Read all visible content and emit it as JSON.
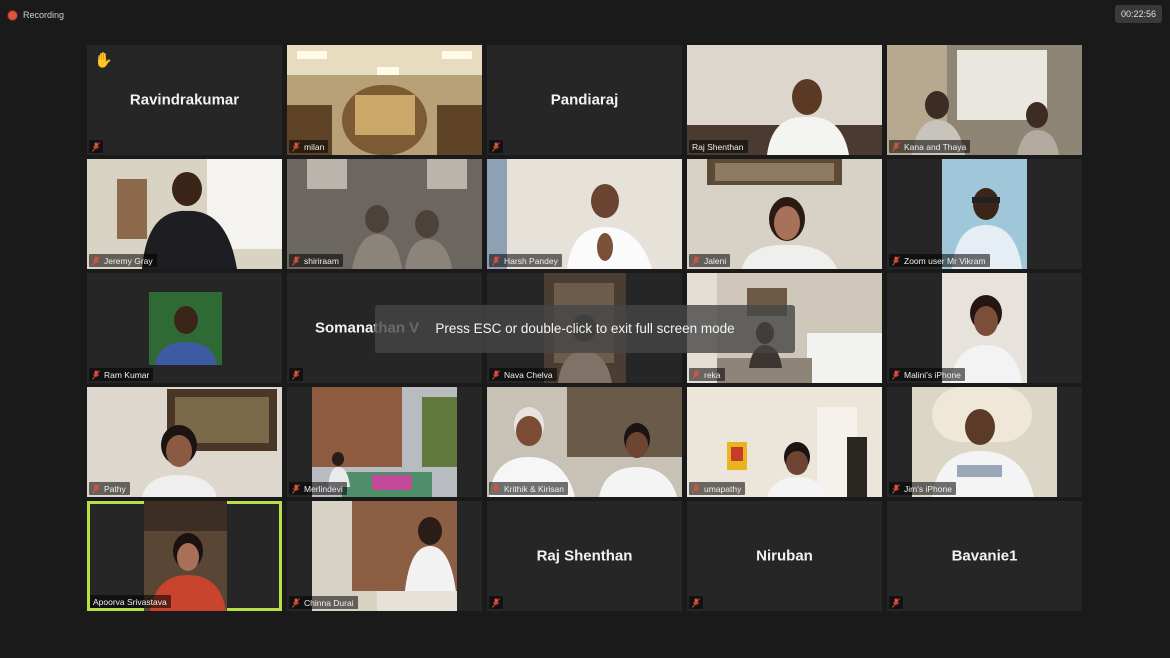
{
  "recording": {
    "label": "Recording"
  },
  "timer": "00:22:56",
  "fullscreen_toast": "Press ESC or double-click to exit full screen mode",
  "participants": [
    {
      "display": "Ravindrakumar",
      "label": "",
      "video": false,
      "hand": true
    },
    {
      "display": "",
      "label": "milan",
      "video": true
    },
    {
      "display": "Pandiaraj",
      "label": "",
      "video": false
    },
    {
      "display": "",
      "label": "Raj Shenthan",
      "video": true
    },
    {
      "display": "",
      "label": "Kana and Thaya",
      "video": true
    },
    {
      "display": "",
      "label": "Jeremy Gray",
      "video": true
    },
    {
      "display": "",
      "label": "shiriraam",
      "video": true
    },
    {
      "display": "",
      "label": "Harsh Pandey",
      "video": true
    },
    {
      "display": "",
      "label": "Jaleni",
      "video": true
    },
    {
      "display": "",
      "label": "Zoom user Mr Vikram",
      "video": true
    },
    {
      "display": "",
      "label": "Ram Kumar",
      "video": true
    },
    {
      "display": "Somanathan V",
      "label": "",
      "video": false
    },
    {
      "display": "",
      "label": "Nava Chelva",
      "video": true
    },
    {
      "display": "",
      "label": "reka",
      "video": true
    },
    {
      "display": "",
      "label": "Malini's iPhone",
      "video": true
    },
    {
      "display": "",
      "label": "Pathy",
      "video": true
    },
    {
      "display": "",
      "label": "Merlindevi",
      "video": true
    },
    {
      "display": "",
      "label": "Krithik & Kirisan",
      "video": true
    },
    {
      "display": "",
      "label": "umapathy",
      "video": true
    },
    {
      "display": "",
      "label": "Jim's iPhone",
      "video": true
    },
    {
      "display": "",
      "label": "Apoorva Srivastava",
      "video": true,
      "active": true,
      "unmuted": true
    },
    {
      "display": "",
      "label": "Chinna Durai",
      "video": true
    },
    {
      "display": "Raj Shenthan",
      "label": "",
      "video": false
    },
    {
      "display": "Niruban",
      "label": "",
      "video": false
    },
    {
      "display": "Bavanie1",
      "label": "",
      "video": false
    }
  ],
  "icons": {
    "mic_muted": "muted-mic-icon",
    "raised_hand": "raised-hand-icon",
    "recording_dot": "recording-dot-icon"
  },
  "colors": {
    "background": "#1a1a1a",
    "tile": "#262626",
    "active_speaker_border": "#b8e045",
    "muted_mic": "#e0533b"
  }
}
